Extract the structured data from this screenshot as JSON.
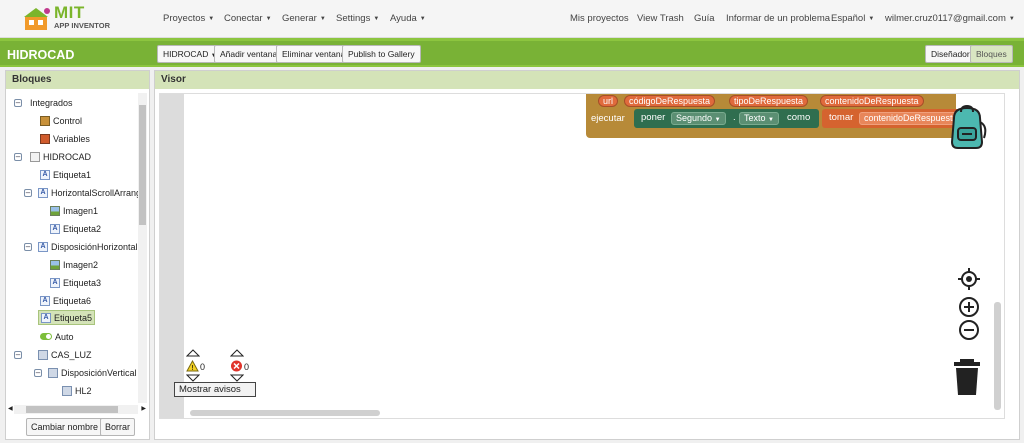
{
  "brand": {
    "logo_title": "MIT",
    "logo_subtitle": "APP INVENTOR"
  },
  "nav": {
    "left": [
      {
        "label": "Proyectos"
      },
      {
        "label": "Conectar"
      },
      {
        "label": "Generar"
      },
      {
        "label": "Settings"
      },
      {
        "label": "Ayuda"
      }
    ],
    "right": [
      {
        "label": "Mis proyectos"
      },
      {
        "label": "View Trash"
      },
      {
        "label": "Guía"
      },
      {
        "label": "Informar de un problema"
      },
      {
        "label": "Español"
      },
      {
        "label": "wilmer.cruz0117@gmail.com"
      }
    ]
  },
  "project": {
    "name": "HIDROCAD",
    "screen_select": "HIDROCAD",
    "add_screen": "Añadir ventana",
    "remove_screen": "Eliminar ventana",
    "publish": "Publish to Gallery",
    "designer": "Diseñador",
    "blocks": "Bloques"
  },
  "bloques": {
    "title": "Bloques",
    "tree": [
      {
        "label": "Integrados",
        "toggle": "minus",
        "icon": "none-icon"
      },
      {
        "label": "Control",
        "icon": "control-icon"
      },
      {
        "label": "Variables",
        "icon": "variables-icon"
      },
      {
        "label": "HIDROCAD",
        "toggle": "minus",
        "icon": "screen-icon"
      },
      {
        "label": "Etiqueta1",
        "icon": "label-icon"
      },
      {
        "label": "HorizontalScrollArrange",
        "toggle": "minus",
        "icon": "layout-icon"
      },
      {
        "label": "Imagen1",
        "icon": "image-icon"
      },
      {
        "label": "Etiqueta2",
        "icon": "label-icon"
      },
      {
        "label": "DisposiciónHorizontal",
        "toggle": "minus",
        "icon": "layout-icon"
      },
      {
        "label": "Imagen2",
        "icon": "image-icon"
      },
      {
        "label": "Etiqueta3",
        "icon": "label-icon"
      },
      {
        "label": "Etiqueta6",
        "icon": "label-icon"
      },
      {
        "label": "Etiqueta5",
        "icon": "label-icon",
        "selected": true
      },
      {
        "label": "Auto",
        "icon": "switch-icon"
      },
      {
        "label": "CAS_LUZ",
        "toggle": "minus",
        "icon": "layout-icon"
      },
      {
        "label": "DisposiciónVertical",
        "toggle": "minus",
        "icon": "layout-icon"
      },
      {
        "label": "HL2",
        "icon": "layout-icon"
      }
    ],
    "rename_button": "Cambiar nombre",
    "delete_button": "Borrar"
  },
  "visor": {
    "title": "Visor",
    "event_params": [
      "url",
      "códigoDeRespuesta",
      "tipoDeRespuesta",
      "contenidoDeRespuesta"
    ],
    "ejecutar": "ejecutar",
    "set_word": "poner",
    "set_component": "Segundo",
    "set_dot": ".",
    "set_property": "Texto",
    "set_como": "como",
    "get_word": "tomar",
    "get_var": "contenidoDeRespuesta",
    "warnings_count": "0",
    "errors_count": "0",
    "show_warnings": "Mostrar avisos"
  }
}
